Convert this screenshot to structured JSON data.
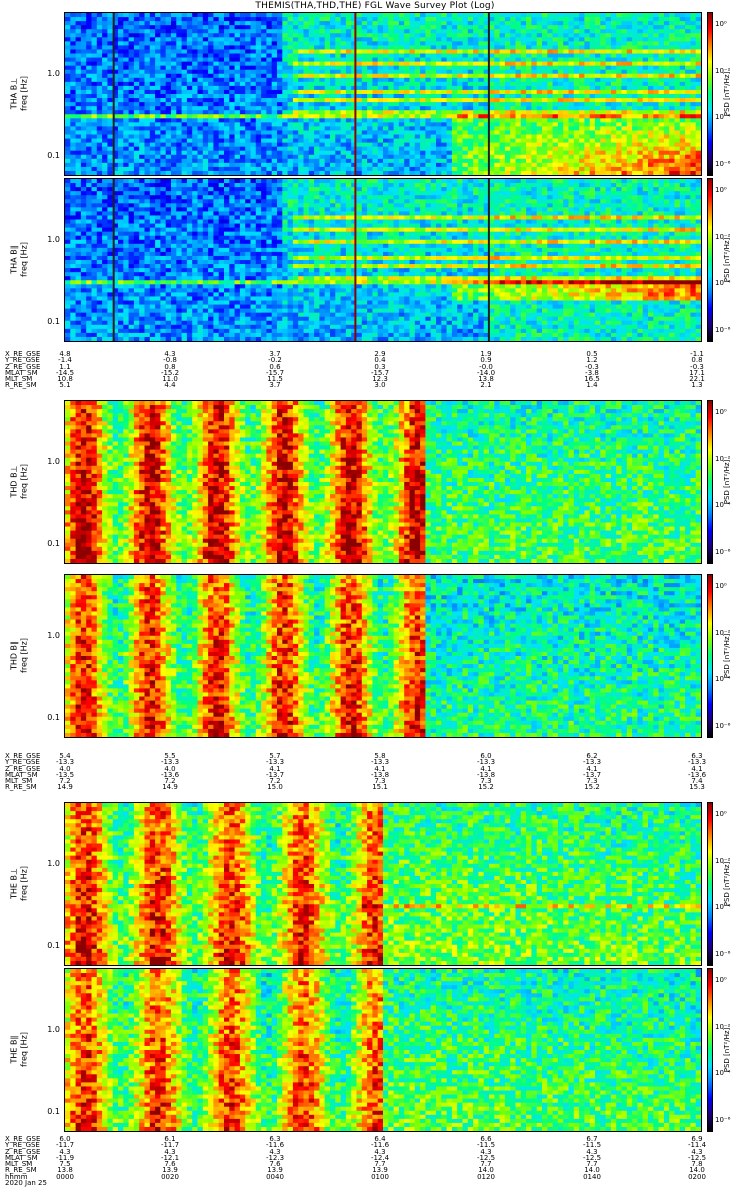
{
  "title": "THEMIS(THA,THD,THE) FGL Wave Survey Plot (Log)",
  "colorbar": {
    "label": "PSD [nT²/Hz]",
    "ticks": [
      "10⁰",
      "10⁻²",
      "10⁻⁴",
      "10⁻⁶"
    ],
    "colors": [
      "#000000",
      "#1d0078",
      "#0000ff",
      "#0080ff",
      "#00e0ff",
      "#00ff80",
      "#80ff00",
      "#ffff00",
      "#ff8000",
      "#ff0000",
      "#8b0000"
    ]
  },
  "freq_ticks": [
    "1.0",
    "0.1"
  ],
  "panels": [
    {
      "sat": "THA B⊥",
      "freq_label": "freq [Hz]"
    },
    {
      "sat": "THA B∥",
      "freq_label": "freq [Hz]"
    },
    {
      "sat": "THD B⊥",
      "freq_label": "freq [Hz]"
    },
    {
      "sat": "THD B∥",
      "freq_label": "freq [Hz]"
    },
    {
      "sat": "THE B⊥",
      "freq_label": "freq [Hz]"
    },
    {
      "sat": "THE B∥",
      "freq_label": "freq [Hz]"
    }
  ],
  "ephemeris": [
    {
      "rows": [
        {
          "name": "X_RE_GSE",
          "values": [
            "4.8",
            "4.3",
            "3.7",
            "2.9",
            "1.9",
            "0.5",
            "-1.1"
          ]
        },
        {
          "name": "Y_RE_GSE",
          "values": [
            "-1.4",
            "-0.8",
            "-0.2",
            "0.4",
            "0.9",
            "1.2",
            "0.8"
          ]
        },
        {
          "name": "Z_RE_GSE",
          "values": [
            "1.1",
            "0.8",
            "0.6",
            "0.3",
            "-0.0",
            "-0.3",
            "-0.3"
          ]
        },
        {
          "name": "MLAT_SM",
          "values": [
            "-14.5",
            "-15.2",
            "-15.7",
            "-15.7",
            "-14.0",
            "-3.8",
            "17.1"
          ]
        },
        {
          "name": "MLT_SM",
          "values": [
            "10.8",
            "11.0",
            "11.5",
            "12.3",
            "13.8",
            "16.5",
            "22.1"
          ]
        },
        {
          "name": "R_RE_SM",
          "values": [
            "5.1",
            "4.4",
            "3.7",
            "3.0",
            "2.1",
            "1.4",
            "1.3"
          ]
        }
      ]
    },
    {
      "rows": [
        {
          "name": "X_RE_GSE",
          "values": [
            "5.4",
            "5.5",
            "5.7",
            "5.8",
            "6.0",
            "6.2",
            "6.3"
          ]
        },
        {
          "name": "Y_RE_GSE",
          "values": [
            "-13.3",
            "-13.3",
            "-13.3",
            "-13.3",
            "-13.3",
            "-13.3",
            "-13.3"
          ]
        },
        {
          "name": "Z_RE_GSE",
          "values": [
            "4.0",
            "4.0",
            "4.1",
            "4.1",
            "4.1",
            "4.1",
            "4.1"
          ]
        },
        {
          "name": "MLAT_SM",
          "values": [
            "-13.5",
            "-13.6",
            "-13.7",
            "-13.8",
            "-13.8",
            "-13.7",
            "-13.6"
          ]
        },
        {
          "name": "MLT_SM",
          "values": [
            "7.2",
            "7.2",
            "7.2",
            "7.3",
            "7.3",
            "7.3",
            "7.4"
          ]
        },
        {
          "name": "R_RE_SM",
          "values": [
            "14.9",
            "14.9",
            "15.0",
            "15.1",
            "15.2",
            "15.2",
            "15.3"
          ]
        }
      ]
    },
    {
      "rows": [
        {
          "name": "X_RE_GSE",
          "values": [
            "6.0",
            "6.1",
            "6.3",
            "6.4",
            "6.6",
            "6.7",
            "6.9"
          ]
        },
        {
          "name": "Y_RE_GSE",
          "values": [
            "-11.7",
            "-11.7",
            "-11.6",
            "-11.6",
            "-11.5",
            "-11.5",
            "-11.4"
          ]
        },
        {
          "name": "Z_RE_GSE",
          "values": [
            "4.3",
            "4.3",
            "4.3",
            "4.3",
            "4.3",
            "4.3",
            "4.3"
          ]
        },
        {
          "name": "MLAT_SM",
          "values": [
            "-11.9",
            "-12.1",
            "-12.3",
            "-12.4",
            "-12.5",
            "-12.5",
            "-12.5"
          ]
        },
        {
          "name": "MLT_SM",
          "values": [
            "7.5",
            "7.6",
            "7.6",
            "7.7",
            "7.7",
            "7.7",
            "7.8"
          ]
        },
        {
          "name": "R_RE_SM",
          "values": [
            "13.8",
            "13.9",
            "13.9",
            "13.9",
            "14.0",
            "14.0",
            "14.0"
          ]
        },
        {
          "name": "hhmm",
          "values": [
            "0000",
            "0020",
            "0040",
            "0100",
            "0120",
            "0140",
            "0200"
          ]
        },
        {
          "name": "2020 Jan 25",
          "values": []
        }
      ]
    }
  ],
  "chart_data": {
    "type": "heatmap",
    "title": "THEMIS(THA,THD,THE) FGL Wave Survey Plot (Log)",
    "x_ticks": [
      "0000",
      "0020",
      "0040",
      "0100",
      "0120",
      "0140",
      "0200"
    ],
    "date": "2020 Jan 25",
    "y_scale": "log",
    "y_ticks": [
      0.1,
      1.0
    ],
    "colorbar_scale": "log",
    "colorbar_ticks": [
      "10⁰",
      "10⁻²",
      "10⁻⁴",
      "10⁻⁶"
    ],
    "series": [
      {
        "name": "THA B⊥"
      },
      {
        "name": "THA B∥"
      },
      {
        "name": "THD B⊥"
      },
      {
        "name": "THD B∥"
      },
      {
        "name": "THE B⊥"
      },
      {
        "name": "THE B∥"
      }
    ]
  }
}
